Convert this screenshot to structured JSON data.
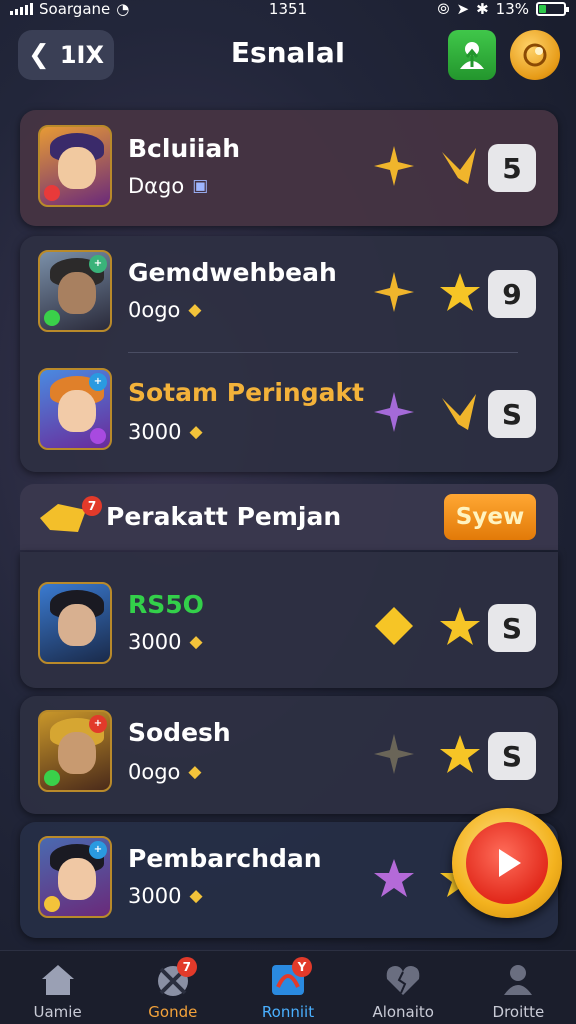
{
  "status": {
    "carrier": "Soargane",
    "time": "1351",
    "battery": "13%"
  },
  "header": {
    "back_label": "1IX",
    "title": "EsnaIaI"
  },
  "colors": {
    "accent_orange": "#f08a12",
    "green_btn": "#2fb33a",
    "gold_name": "#f3b23a",
    "green_name": "#33d04a"
  },
  "cards": [
    {
      "name": "Bcluiiah",
      "value": "Dαgo",
      "value_icon": "gift-icon",
      "star1": "gold-shuriken-icon",
      "star2": "gold-wing-icon",
      "price": "5"
    },
    {
      "name": "Gemdwehbeah",
      "value": "0ogo",
      "value_icon": "coin-bag-icon",
      "star1": "gold-shuriken-icon",
      "star2": "gold-star-icon",
      "price": "9"
    },
    {
      "name": "Sotam Peringakt",
      "value": "3000",
      "value_icon": "coin-bag-icon",
      "star1": "purple-shuriken-icon",
      "star2": "gold-wing-icon",
      "price": "S"
    },
    {
      "name": "RS5O",
      "value": "3000",
      "value_icon": "coin-bag-icon",
      "star1": "gold-diamond-icon",
      "star2": "gold-star-icon",
      "price": "S"
    },
    {
      "name": "Sodesh",
      "value": "0ogo",
      "value_icon": "coin-bag-icon",
      "star1": "gray-shuriken-icon",
      "star2": "gold-star-icon",
      "price": "S"
    },
    {
      "name": "Pembarchdan",
      "value": "3000",
      "value_icon": "coin-bag-icon",
      "star1": "purple-star-icon",
      "star2": "gold-star-icon"
    }
  ],
  "section": {
    "title": "Perakatt Pemjan",
    "badge": "7",
    "view_label": "Syew"
  },
  "nav": [
    {
      "label": "Uamie",
      "icon": "home-icon",
      "badge": ""
    },
    {
      "label": "Gonde",
      "icon": "swords-icon",
      "badge": "7"
    },
    {
      "label": "Ronniit",
      "icon": "ribbon-icon",
      "badge": "Y"
    },
    {
      "label": "Alonaito",
      "icon": "broken-heart-icon",
      "badge": ""
    },
    {
      "label": "Droitte",
      "icon": "profile-icon",
      "badge": ""
    }
  ]
}
